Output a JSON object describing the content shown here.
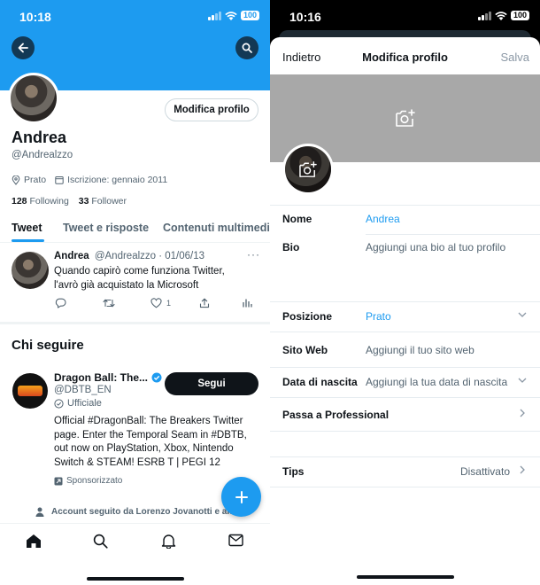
{
  "left": {
    "status": {
      "time": "10:18",
      "battery": "100"
    },
    "header": {
      "back_icon": "arrow-left-icon",
      "search_icon": "search-icon",
      "banner_color": "#1d9bf0"
    },
    "profile": {
      "edit_button": "Modifica profilo",
      "name": "Andrea",
      "handle": "@Andrealzzo",
      "location": "Prato",
      "joined": "Iscrizione: gennaio 2011",
      "following_count": "128",
      "following_label": "Following",
      "followers_count": "33",
      "followers_label": "Follower"
    },
    "tabs": [
      {
        "label": "Tweet",
        "active": true
      },
      {
        "label": "Tweet e risposte",
        "active": false
      },
      {
        "label": "Contenuti multimedia",
        "active": false
      }
    ],
    "tweet": {
      "name": "Andrea",
      "meta": "@Andrealzzo · 01/06/13",
      "text": "Quando capirò come funziona Twitter, l'avrò già acquistato la Microsoft",
      "like_count": "1"
    },
    "who_to_follow": {
      "title": "Chi seguire",
      "account_name": "Dragon Ball: The...",
      "account_handle": "@DBTB_EN",
      "official_label": "Ufficiale",
      "follow_button": "Segui",
      "bio": "Official #DragonBall: The Breakers Twitter page. Enter the Temporal Seam in #DBTB, out now on PlayStation, Xbox, Nintendo Switch & STEAM! ESRB T | PEGI 12",
      "sponsored": "Sponsorizzato",
      "followed_by": "Account seguito da Lorenzo Jovanotti e altri 3"
    },
    "accent": "#1d9bf0"
  },
  "right": {
    "status": {
      "time": "10:16",
      "battery": "100"
    },
    "sheet": {
      "back": "Indietro",
      "title": "Modifica profilo",
      "save": "Salva"
    },
    "fields": {
      "name_label": "Nome",
      "name_value": "Andrea",
      "bio_label": "Bio",
      "bio_placeholder": "Aggiungi una bio al tuo profilo",
      "location_label": "Posizione",
      "location_value": "Prato",
      "website_label": "Sito Web",
      "website_placeholder": "Aggiungi il tuo sito web",
      "birth_label": "Data di nascita",
      "birth_placeholder": "Aggiungi la tua data di nascita",
      "professional_label": "Passa a Professional",
      "tips_label": "Tips",
      "tips_value": "Disattivato"
    }
  }
}
